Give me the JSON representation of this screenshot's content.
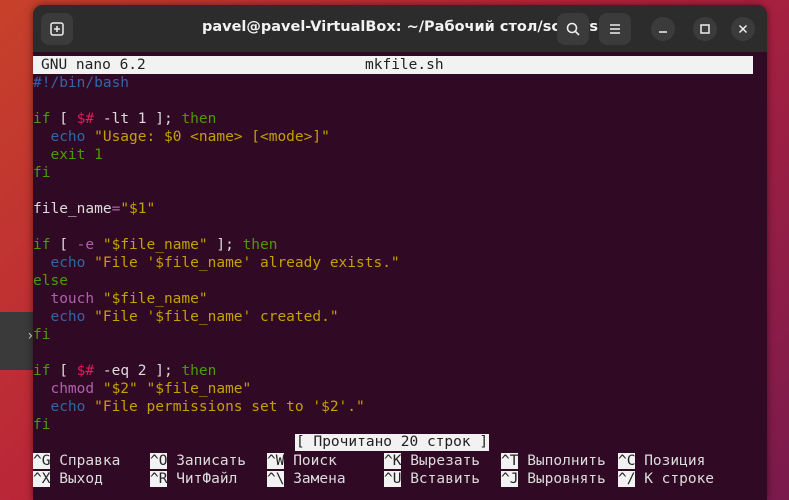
{
  "window": {
    "title": "pavel@pavel-VirtualBox: ~/Рабочий стол/scripts"
  },
  "nano": {
    "version": "GNU nano 6.2",
    "filename": "mkfile.sh",
    "status": "[ Прочитано 20 строк ]"
  },
  "code": {
    "l1": "#!/bin/bash",
    "l3a": "if",
    "l3b": " [ ",
    "l3c": "$#",
    "l3d": " -lt 1 ]; ",
    "l3e": "then",
    "l4a": "  echo",
    "l4b": " \"Usage: $0 <name> [<mode>]\"",
    "l5": "  exit 1",
    "l6": "fi",
    "l8a": "file_name",
    "l8b": "=",
    "l8c": "\"$1\"",
    "l10a": "if",
    "l10b": " [ ",
    "l10c": "-e",
    "l10d": " \"$file_name\"",
    "l10e": " ]; ",
    "l10f": "then",
    "l11a": "  echo",
    "l11b": " \"File '$file_name' already exists.\"",
    "l12": "else",
    "l13a": "  touch",
    "l13b": " \"$file_name\"",
    "l14a": "  echo",
    "l14b": " \"File '$file_name' created.\"",
    "l15": "fi",
    "l17a": "if",
    "l17b": " [ ",
    "l17c": "$#",
    "l17d": " -eq 2 ]; ",
    "l17e": "then",
    "l18a": "  chmod",
    "l18b": " \"$2\" \"$file_name\"",
    "l19a": "  echo",
    "l19b": " \"File permissions set to '$2'.\"",
    "l20": "fi"
  },
  "help_row1": [
    {
      "key": "^G",
      "label": " Справка"
    },
    {
      "key": "^O",
      "label": " Записать"
    },
    {
      "key": "^W",
      "label": " Поиск"
    },
    {
      "key": "^K",
      "label": " Вырезать"
    },
    {
      "key": "^T",
      "label": " Выполнить"
    },
    {
      "key": "^C",
      "label": " Позиция"
    }
  ],
  "help_row2": [
    {
      "key": "^X",
      "label": " Выход"
    },
    {
      "key": "^R",
      "label": " ЧитФайл"
    },
    {
      "key": "^\\",
      "label": " Замена"
    },
    {
      "key": "^U",
      "label": " Вставить"
    },
    {
      "key": "^J",
      "label": " Выровнять"
    },
    {
      "key": "^/",
      "label": " К строке"
    }
  ],
  "icons": {
    "new_tab": "new-tab-icon",
    "search": "search-icon",
    "menu": "hamburger-menu-icon",
    "minimize": "minimize-icon",
    "maximize": "maximize-icon",
    "close": "close-icon"
  }
}
